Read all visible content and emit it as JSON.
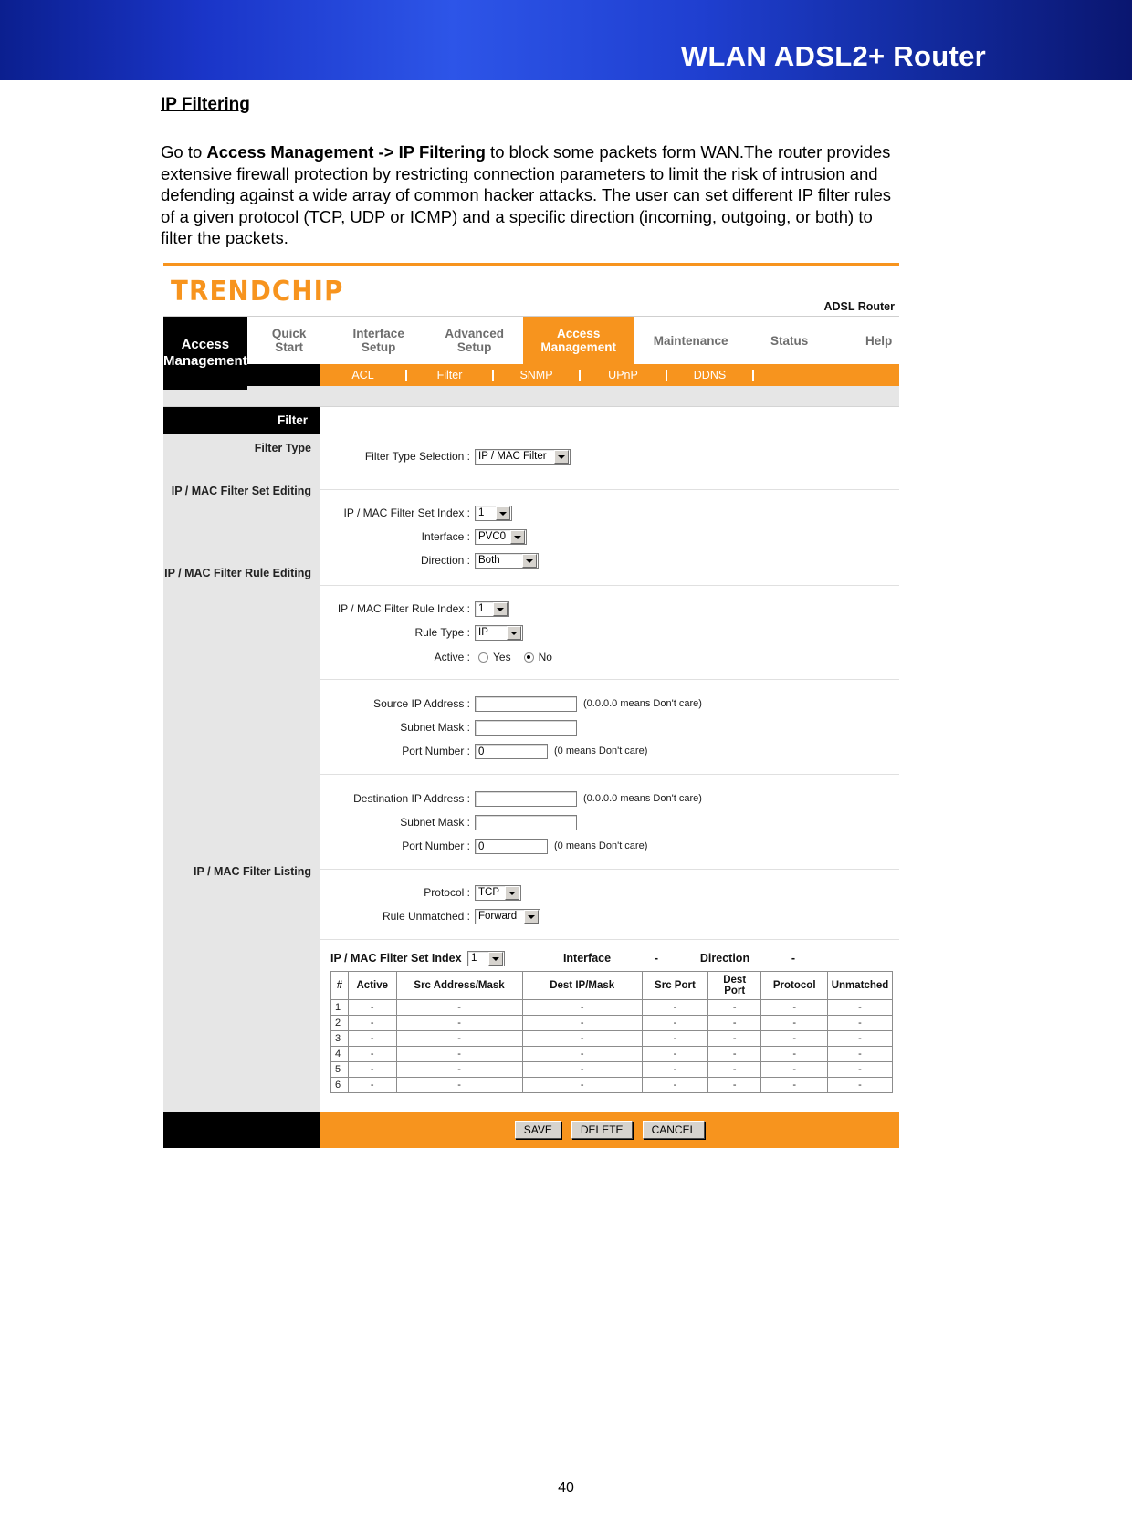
{
  "banner": {
    "title": "WLAN ADSL2+ Router"
  },
  "document": {
    "heading": "IP Filtering",
    "paragraph_prefix": "Go to ",
    "paragraph_bold": "Access Management -> IP Filtering",
    "paragraph_rest": " to block some packets form WAN.The router provides extensive firewall protection by restricting connection parameters to limit the risk of intrusion and defending against a wide array of common hacker attacks. The user can set different IP filter rules of a given protocol (TCP, UDP or ICMP) and a specific direction (incoming, outgoing, or both) to filter the packets."
  },
  "router_ui": {
    "brand": "TRENDCHIP",
    "brand_right": "ADSL Router",
    "current_section": "Access\nManagement",
    "nav": [
      {
        "label": "Quick\nStart",
        "active": false
      },
      {
        "label": "Interface\nSetup",
        "active": false
      },
      {
        "label": "Advanced\nSetup",
        "active": false
      },
      {
        "label": "Access\nManagement",
        "active": true
      },
      {
        "label": "Maintenance",
        "active": false
      },
      {
        "label": "Status",
        "active": false
      },
      {
        "label": "Help",
        "active": false
      }
    ],
    "subnav": [
      "ACL",
      "Filter",
      "SNMP",
      "UPnP",
      "DDNS"
    ],
    "page_title": "Filter",
    "groups": {
      "filter_type": "Filter Type",
      "set_editing": "IP / MAC Filter Set Editing",
      "rule_editing": "IP / MAC Filter Rule Editing",
      "listing": "IP / MAC Filter Listing"
    },
    "fields": {
      "filter_type_selection_label": "Filter Type Selection :",
      "filter_type_selection_value": "IP / MAC Filter",
      "set_index_label": "IP / MAC Filter Set Index :",
      "set_index_value": "1",
      "interface_label": "Interface :",
      "interface_value": "PVC0",
      "direction_label": "Direction :",
      "direction_value": "Both",
      "rule_index_label": "IP / MAC Filter Rule Index :",
      "rule_index_value": "1",
      "rule_type_label": "Rule Type :",
      "rule_type_value": "IP",
      "active_label": "Active :",
      "active_yes": "Yes",
      "active_no": "No",
      "active_selected": "No",
      "source_ip_label": "Source IP Address :",
      "source_ip_value": "",
      "source_mask_label": "Subnet Mask :",
      "source_mask_value": "",
      "source_port_label": "Port Number :",
      "source_port_value": "0",
      "ip_hint": "(0.0.0.0 means Don't care)",
      "port_hint": "(0 means Don't care)",
      "dest_ip_label": "Destination IP Address :",
      "dest_ip_value": "",
      "dest_mask_label": "Subnet Mask :",
      "dest_mask_value": "",
      "dest_port_label": "Port Number :",
      "dest_port_value": "0",
      "protocol_label": "Protocol :",
      "protocol_value": "TCP",
      "rule_unmatched_label": "Rule Unmatched :",
      "rule_unmatched_value": "Forward"
    },
    "listing": {
      "set_index_label": "IP / MAC Filter Set Index",
      "set_index_value": "1",
      "interface_label": "Interface",
      "interface_value": "-",
      "direction_label": "Direction",
      "direction_value": "-",
      "columns": [
        "#",
        "Active",
        "Src Address/Mask",
        "Dest IP/Mask",
        "Src Port",
        "Dest\nPort",
        "Protocol",
        "Unmatched"
      ],
      "rows": [
        [
          "1",
          "-",
          "-",
          "-",
          "-",
          "-",
          "-",
          "-"
        ],
        [
          "2",
          "-",
          "-",
          "-",
          "-",
          "-",
          "-",
          "-"
        ],
        [
          "3",
          "-",
          "-",
          "-",
          "-",
          "-",
          "-",
          "-"
        ],
        [
          "4",
          "-",
          "-",
          "-",
          "-",
          "-",
          "-",
          "-"
        ],
        [
          "5",
          "-",
          "-",
          "-",
          "-",
          "-",
          "-",
          "-"
        ],
        [
          "6",
          "-",
          "-",
          "-",
          "-",
          "-",
          "-",
          "-"
        ]
      ]
    },
    "buttons": {
      "save": "SAVE",
      "delete": "DELETE",
      "cancel": "CANCEL"
    }
  },
  "page_number": "40",
  "colors": {
    "accent": "#F7941E",
    "banner": "#1a35c8"
  }
}
